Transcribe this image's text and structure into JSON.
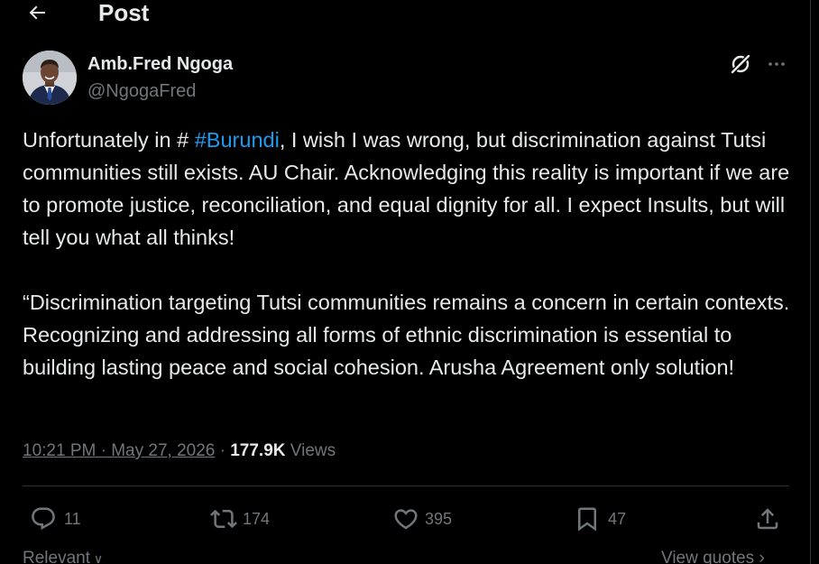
{
  "header": {
    "title": "Post"
  },
  "author": {
    "name": "Amb.Fred Ngoga",
    "handle": "@NgogaFred"
  },
  "post": {
    "p1_before": "Unfortunately in # ",
    "p1_hashtag": "#Burundi",
    "p1_after": ", I wish I was wrong, but discrimination against Tutsi communities still exists. AU Chair. Acknowledging this reality is important if we are to promote justice, reconciliation, and equal dignity for all. I expect Insults, but will tell you what all thinks!",
    "p2": "“Discrimination targeting Tutsi communities remains a concern in certain contexts. Recognizing and addressing all forms of ethnic discrimination is essential to building lasting peace and social cohesion. Arusha Agreement only solution!"
  },
  "meta": {
    "timestamp": "10:21 PM · May 27, 2026",
    "separator": " · ",
    "views_count": "177.9K",
    "views_label": " Views"
  },
  "actions": {
    "replies": "11",
    "reposts": "174",
    "likes": "395",
    "bookmarks": "47"
  },
  "footer": {
    "sort_label": "Relevant",
    "quotes_label": "View quotes"
  },
  "colors": {
    "background": "#000000",
    "text": "#e7e9ea",
    "muted": "#71767b",
    "accent": "#1d9bf0",
    "border": "#2f3336"
  },
  "icons": {
    "back": "arrow-left-icon",
    "grok": "grok-icon",
    "more": "more-horizontal-icon",
    "reply": "reply-icon",
    "repost": "repost-icon",
    "like": "heart-icon",
    "bookmark": "bookmark-icon",
    "share": "share-icon"
  }
}
